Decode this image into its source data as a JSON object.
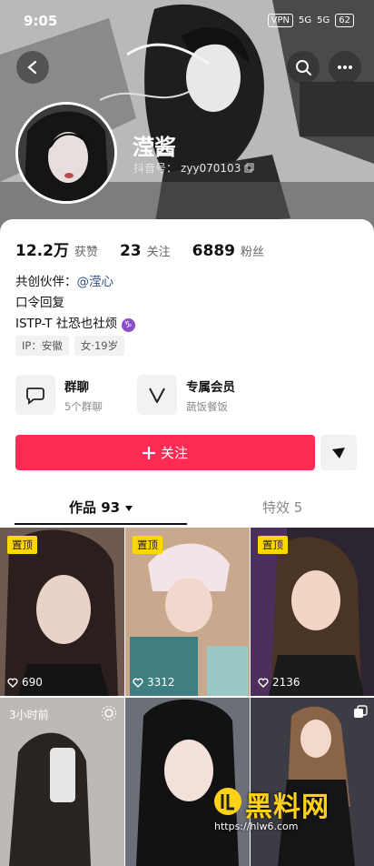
{
  "status_bar": {
    "time": "9:05",
    "vpn": "VPN",
    "signal1": "5G",
    "signal2": "5G",
    "battery": "62"
  },
  "header": {
    "nickname": "滢酱",
    "douyin_id_label": "抖音号：",
    "douyin_id": "zyy070103"
  },
  "stats": [
    {
      "value": "12.2万",
      "label": "获赞"
    },
    {
      "value": "23",
      "label": "关注"
    },
    {
      "value": "6889",
      "label": "粉丝"
    }
  ],
  "bio": {
    "partner_label": "共创伙伴：",
    "partner_mention": "@滢心",
    "line2": "口令回复",
    "line3": "ISTP-T 社恐也社烦",
    "zodiac": "♑"
  },
  "tags": [
    "IP：安徽",
    "女·19岁"
  ],
  "features": [
    {
      "title": "群聊",
      "subtitle": "5个群聊",
      "icon": "chat-bubble-icon"
    },
    {
      "title": "专属会员",
      "subtitle": "蔬饭餐饭",
      "icon": "vip-heart-icon"
    }
  ],
  "follow_button": {
    "label": "关注",
    "color": "#fe2c55"
  },
  "tabs": {
    "works": "作品 93",
    "effects": "特效 5"
  },
  "posts": [
    {
      "pinned": "置顶",
      "likes": "690"
    },
    {
      "pinned": "置顶",
      "likes": "3312"
    },
    {
      "pinned": "置顶",
      "likes": "2136"
    },
    {
      "time_ago": "3小时前"
    },
    {},
    {}
  ],
  "watermark": {
    "text": "黑料网",
    "url": "https://hlw6.com"
  }
}
